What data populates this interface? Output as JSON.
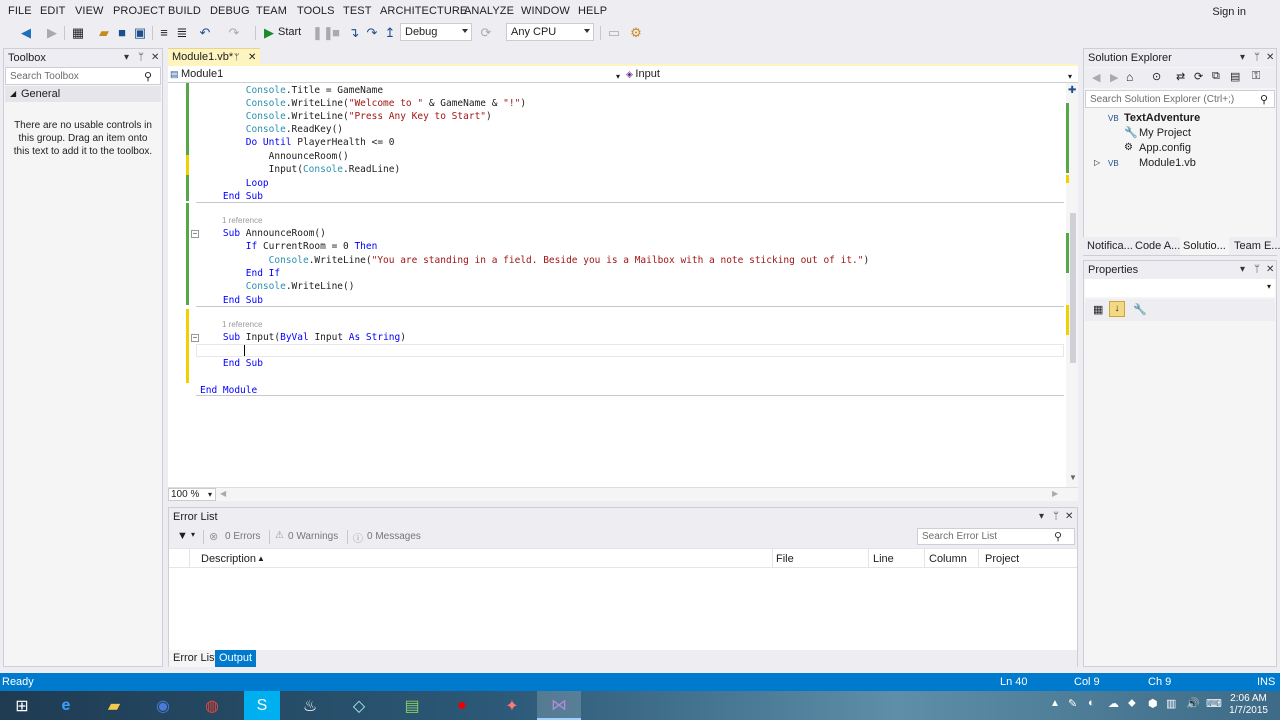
{
  "menu": [
    "FILE",
    "EDIT",
    "VIEW",
    "PROJECT",
    "BUILD",
    "DEBUG",
    "TEAM",
    "TOOLS",
    "TEST",
    "ARCHITECTURE",
    "ANALYZE",
    "WINDOW",
    "HELP"
  ],
  "signin": "Sign in",
  "toolbar": {
    "start_label": "Start",
    "config": "Debug",
    "platform": "Any CPU"
  },
  "toolbox": {
    "title": "Toolbox",
    "search_placeholder": "Search Toolbox",
    "group": "General",
    "empty_text": "There are no usable controls in this group. Drag an item onto this text to add it to the toolbox."
  },
  "editor": {
    "tab_label": "Module1.vb*",
    "nav_left": "Module1",
    "nav_right": "Input",
    "zoom": "100 %",
    "reference_label": "1 reference",
    "lines": [
      "        Console.Title = GameName",
      "        Console.WriteLine(\"Welcome to \" & GameName & \"!\")",
      "        Console.WriteLine(\"Press Any Key to Start\")",
      "        Console.ReadKey()",
      "        Do Until PlayerHealth <= 0",
      "            AnnounceRoom()",
      "            Input(Console.ReadLine)",
      "        Loop",
      "    End Sub",
      "    Sub AnnounceRoom()",
      "        If CurrentRoom = 0 Then",
      "            Console.WriteLine(\"You are standing in a field. Beside you is a Mailbox with a note sticking out of it.\")",
      "        End If",
      "        Console.WriteLine()",
      "    End Sub",
      "    Sub Input(ByVal Input As String)",
      "",
      "    End Sub",
      "End Module"
    ]
  },
  "errorlist": {
    "title": "Error List",
    "errors": "0 Errors",
    "warnings": "0 Warnings",
    "messages": "0 Messages",
    "search_placeholder": "Search Error List",
    "columns": [
      "Description",
      "File",
      "Line",
      "Column",
      "Project"
    ],
    "tabs": [
      "Error List",
      "Output"
    ]
  },
  "solution_explorer": {
    "title": "Solution Explorer",
    "search_placeholder": "Search Solution Explorer (Ctrl+;)",
    "root": "TextAdventure",
    "items": [
      "My Project",
      "App.config",
      "Module1.vb"
    ],
    "tabs": [
      "Notifica...",
      "Code A...",
      "Solutio...",
      "Team E..."
    ]
  },
  "properties": {
    "title": "Properties"
  },
  "status": {
    "ready": "Ready",
    "ln": "Ln 40",
    "col": "Col 9",
    "ch": "Ch 9",
    "ins": "INS"
  },
  "clock": {
    "time": "2:06 AM",
    "date": "1/7/2015"
  }
}
